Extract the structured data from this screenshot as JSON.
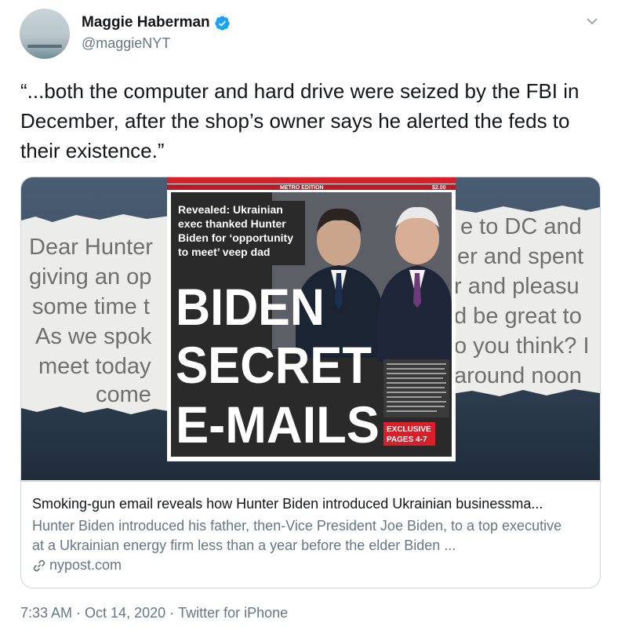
{
  "author": {
    "name": "Maggie Haberman",
    "handle": "@maggieNYT",
    "verified_icon": "verified-badge-icon",
    "accent": "#1da1f2"
  },
  "tweet": {
    "text": "“...both the computer and hard drive were seized by the FBI in December, after the shop’s owner says he alerted the feds to their existence.”",
    "time": "7:33 AM",
    "sep1": "·",
    "date": "Oct 14, 2020",
    "sep2": "·",
    "source": "Twitter for iPhone"
  },
  "card": {
    "title": "Smoking-gun email reveals how Hunter Biden introduced Ukrainian businessma...",
    "description": "Hunter Biden introduced his father, then-Vice President Joe Biden, to a top executive at a Ukrainian energy firm less than a year before the elder Biden ...",
    "domain": "nypost.com",
    "image": {
      "left_letter_lines": [
        "Dear Hunter",
        "giving an op",
        "some time t",
        "As we spok",
        "meet today",
        "come"
      ],
      "right_letter_lines": [
        "e to DC and",
        "er and spent",
        "r and pleasu",
        "d be great to",
        "o you think? I",
        "around noon"
      ],
      "masthead": "METRO EDITION",
      "price": "$2.00",
      "kicker": "Revealed: Ukrainian exec thanked Hunter Biden for ‘opportunity to meet’ veep dad",
      "kicker_lines": [
        "Revealed: Ukrainian",
        "exec thanked Hunter",
        "Biden for ‘opportunity",
        "to meet’ veep dad"
      ],
      "headline_lines": [
        "BIDEN",
        "SECRET",
        "E-MAILS"
      ],
      "exclusive": "EXCLUSIVE",
      "pages": "PAGES 4-7"
    }
  }
}
